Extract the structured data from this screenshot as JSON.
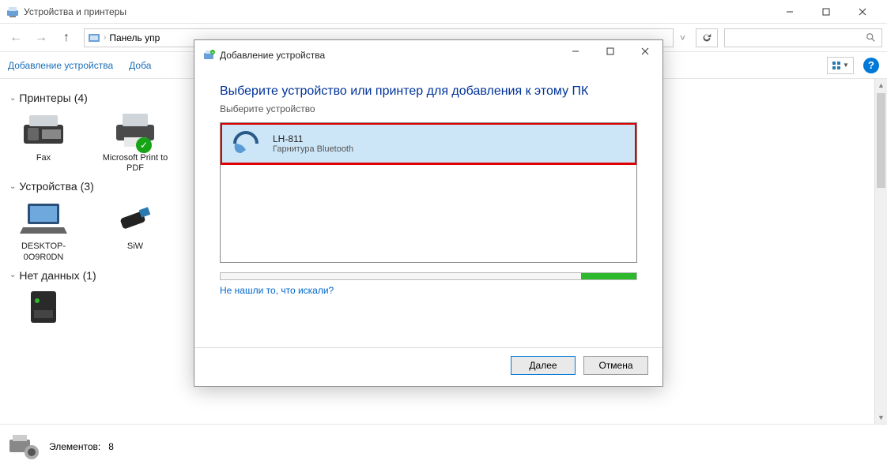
{
  "window": {
    "title": "Устройства и принтеры"
  },
  "breadcrumb": {
    "seg1": "Панель упр"
  },
  "search": {
    "placeholder": ""
  },
  "cmdbar": {
    "add_device": "Добавление устройства",
    "add_prefix": "Доба"
  },
  "groups": {
    "printers": {
      "label": "Принтеры",
      "count": "(4)"
    },
    "devices": {
      "label": "Устройства",
      "count": "(3)"
    },
    "nodata": {
      "label": "Нет данных",
      "count": "(1)"
    }
  },
  "items": {
    "fax": "Fax",
    "mspdf": "Microsoft Print to PDF",
    "desktop": "DESKTOP-0O9R0DN",
    "siw": "SiW"
  },
  "statusbar": {
    "label": "Элементов:",
    "count": "8"
  },
  "dialog": {
    "title": "Добавление устройства",
    "heading": "Выберите устройство или принтер для добавления к этому ПК",
    "sub": "Выберите устройство",
    "device": {
      "name": "LH-811",
      "type": "Гарнитура Bluetooth"
    },
    "notfound": "Не нашли то, что искали?",
    "next": "Далее",
    "cancel": "Отмена"
  }
}
